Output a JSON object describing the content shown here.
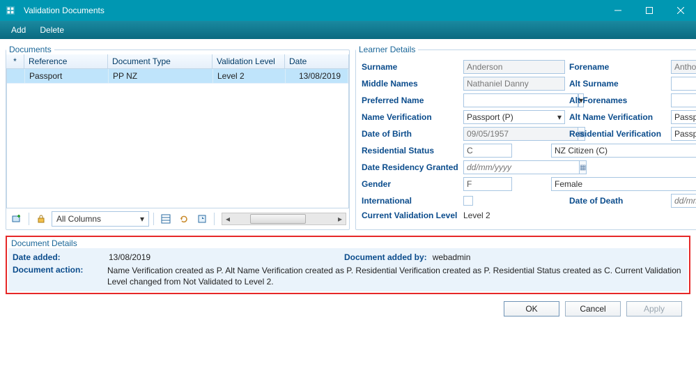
{
  "window": {
    "title": "Validation Documents"
  },
  "menu": {
    "add": "Add",
    "delete": "Delete"
  },
  "documents": {
    "legend": "Documents",
    "headers": {
      "star": "*",
      "reference": "Reference",
      "doctype": "Document Type",
      "validation": "Validation Level",
      "date": "Date"
    },
    "rows": [
      {
        "reference": "Passport",
        "doctype": "PP NZ",
        "validation": "Level 2",
        "date": "13/08/2019"
      }
    ],
    "col_selector": "All Columns"
  },
  "learner": {
    "legend": "Learner Details",
    "surname_lbl": "Surname",
    "surname": "Anderson",
    "forename_lbl": "Forename",
    "forename": "Anthony",
    "middle_lbl": "Middle Names",
    "middle": "Nathaniel Danny",
    "altsurname_lbl": "Alt Surname",
    "altsurname": "",
    "prefname_lbl": "Preferred Name",
    "prefname": "",
    "altfore_lbl": "Alt Forenames",
    "altfore": "",
    "nameverif_lbl": "Name Verification",
    "nameverif": "Passport (P)",
    "altnameverif_lbl": "Alt Name Verification",
    "altnameverif": "Passport (P)",
    "dob_lbl": "Date of Birth",
    "dob": "09/05/1957",
    "resverif_lbl": "Residential Verification",
    "resverif": "Passport (P)",
    "resstatus_lbl": "Residential Status",
    "resstatus_code": "C",
    "resstatus_name": "NZ Citizen (C)",
    "resgrant_lbl": "Date Residency Granted",
    "resgrant_ph": "dd/mm/yyyy",
    "gender_lbl": "Gender",
    "gender_code": "F",
    "gender_name": "Female",
    "intl_lbl": "International",
    "dod_lbl": "Date of Death",
    "dod_ph": "dd/mm/yyyy",
    "curval_lbl": "Current Validation Level",
    "curval": "Level 2"
  },
  "details": {
    "legend": "Document Details",
    "added_lbl": "Date added:",
    "added": "13/08/2019",
    "addedby_lbl": "Document added by:",
    "addedby": "webadmin",
    "action_lbl": "Document action:",
    "action": "Name Verification created as P. Alt Name Verification created as P. Residential Verification created as P. Residential Status created as C. Current Validation Level changed from Not Validated to Level 2."
  },
  "buttons": {
    "ok": "OK",
    "cancel": "Cancel",
    "apply": "Apply"
  }
}
